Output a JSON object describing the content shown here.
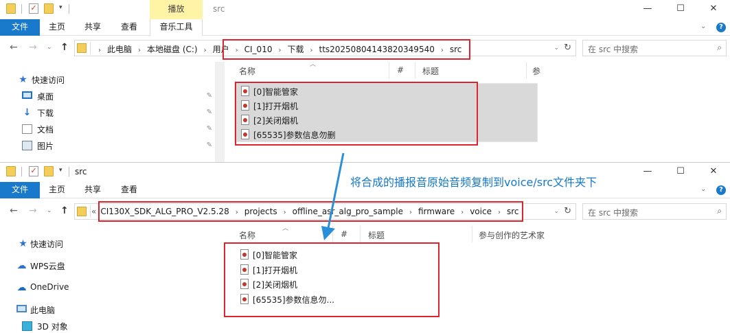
{
  "window1": {
    "title": "src",
    "context_tab": "播放",
    "ribbon": {
      "file": "文件",
      "tabs": [
        "主页",
        "共享",
        "查看"
      ],
      "context_tool": "音乐工具"
    },
    "crumbs": [
      "此电脑",
      "本地磁盘 (C:)",
      "用户",
      "CI_010",
      "下载",
      "tts20250804143820349540",
      "src"
    ],
    "search_placeholder": "在 src 中搜索",
    "nav": [
      {
        "label": "快速访问",
        "icon": "star-icon"
      },
      {
        "label": "桌面",
        "icon": "desktop-icon",
        "pinned": true
      },
      {
        "label": "下载",
        "icon": "download-icon",
        "pinned": true
      },
      {
        "label": "文档",
        "icon": "document-icon",
        "pinned": true
      },
      {
        "label": "图片",
        "icon": "pictures-icon",
        "pinned": true
      }
    ],
    "columns": [
      "名称",
      "#",
      "标题",
      "参"
    ],
    "files": [
      "[0]智能管家",
      "[1]打开烟机",
      "[2]关闭烟机",
      "[65535]参数信息勿删"
    ]
  },
  "window2": {
    "title": "src",
    "ribbon": {
      "file": "文件",
      "tabs": [
        "主页",
        "共享",
        "查看"
      ]
    },
    "crumbs_prefix": "«",
    "crumbs": [
      "CI130X_SDK_ALG_PRO_V2.5.28",
      "projects",
      "offline_asr_alg_pro_sample",
      "firmware",
      "voice",
      "src"
    ],
    "search_placeholder": "在 src 中搜索",
    "nav": [
      {
        "label": "快速访问",
        "icon": "star-icon"
      },
      {
        "label": "WPS云盘",
        "icon": "wps-cloud-icon"
      },
      {
        "label": "OneDrive",
        "icon": "onedrive-icon"
      },
      {
        "label": "此电脑",
        "icon": "this-pc-icon"
      },
      {
        "label": "3D 对象",
        "icon": "3d-objects-icon"
      }
    ],
    "columns": [
      "名称",
      "#",
      "标题",
      "参与创作的艺术家"
    ],
    "files": [
      "[0]智能管家",
      "[1]打开烟机",
      "[2]关闭烟机",
      "[65535]参数信息勿..."
    ]
  },
  "annotation": "将合成的播报音原始音频复制到voice/src文件夹下",
  "colors": {
    "accent": "#1979ca",
    "annotation": "#1578c8",
    "highlight_box": "#d9252b"
  }
}
